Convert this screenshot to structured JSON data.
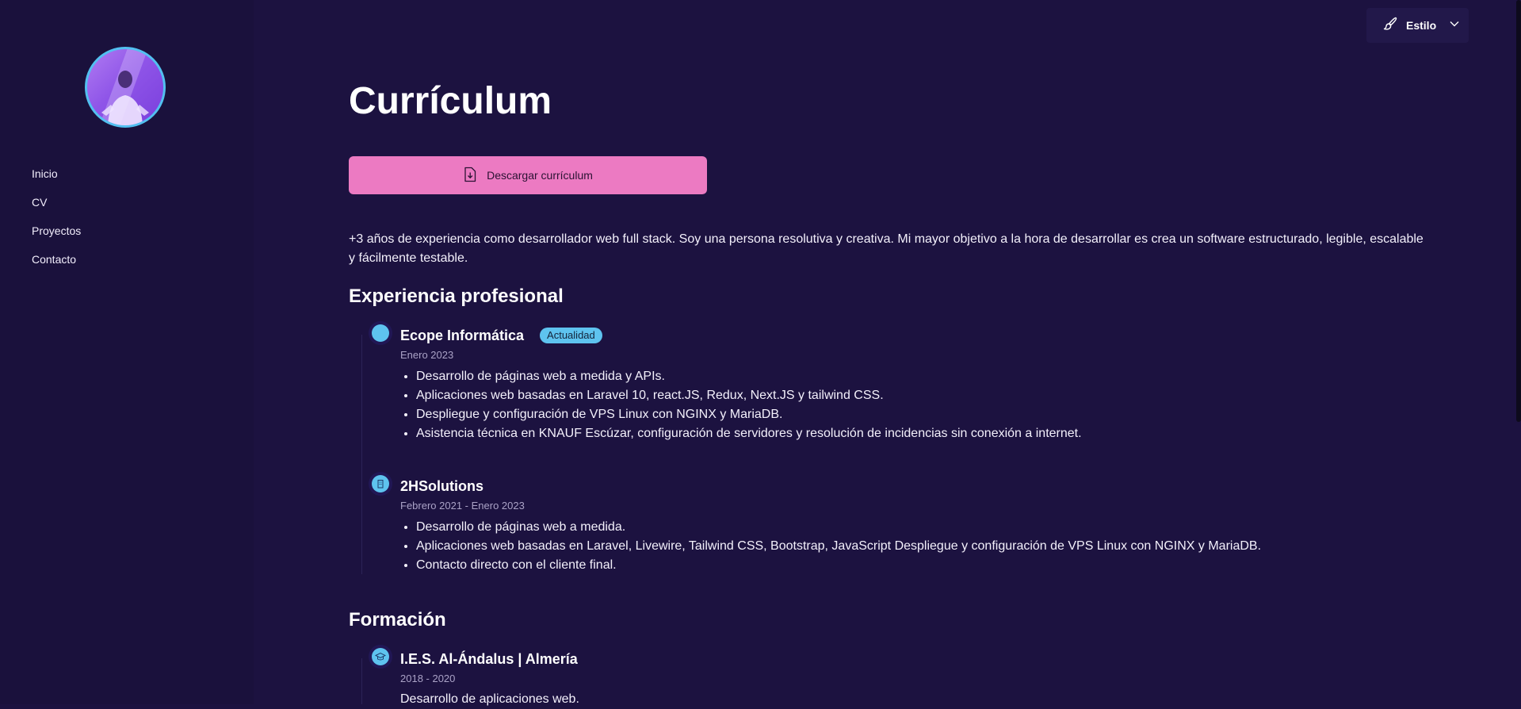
{
  "header": {
    "style_label": "Estilo",
    "style_icon": "brush-icon",
    "chevron_icon": "chevron-down-icon"
  },
  "sidebar": {
    "avatar_icon": "avatar",
    "items": [
      {
        "label": "Inicio"
      },
      {
        "label": "CV"
      },
      {
        "label": "Proyectos"
      },
      {
        "label": "Contacto"
      }
    ]
  },
  "main": {
    "title": "Currículum",
    "download_label": "Descargar currículum",
    "download_icon": "file-download-icon",
    "intro": "+3 años de experiencia como desarrollador web full stack. Soy una persona resolutiva y creativa. Mi mayor objetivo a la hora de desarrollar es crea un software estructurado, legible, escalable y fácilmente testable."
  },
  "experience": {
    "title": "Experiencia profesional",
    "jobs": [
      {
        "company": "Ecope Informática",
        "badge": "Actualidad",
        "date": "Enero 2023",
        "items": [
          "Desarrollo de páginas web a medida y APIs.",
          "Aplicaciones web basadas en Laravel 10, react.JS, Redux, Next.JS y tailwind CSS.",
          "Despliegue y configuración de VPS Linux con NGINX y MariaDB.",
          "Asistencia técnica en KNAUF Escúzar, configuración de servidores y resolución de incidencias sin conexión a internet."
        ]
      },
      {
        "company": "2HSolutions",
        "date": "Febrero 2021 - Enero 2023",
        "items": [
          "Desarrollo de páginas web a medida.",
          "Aplicaciones web basadas en Laravel, Livewire, Tailwind CSS, Bootstrap, JavaScript Despliegue y configuración de VPS Linux con NGINX y MariaDB.",
          "Contacto directo con el cliente final."
        ]
      }
    ]
  },
  "education": {
    "title": "Formación",
    "items": [
      {
        "school": "I.E.S. Al-Ándalus | Almería",
        "date": "2018 - 2020",
        "items": [
          "Desarrollo de aplicaciones web."
        ]
      }
    ]
  },
  "colors": {
    "background": "#1c1240",
    "sidebar": "#1a113c",
    "accent_pink": "#ec7ac2",
    "accent_blue": "#5ec3ef"
  }
}
